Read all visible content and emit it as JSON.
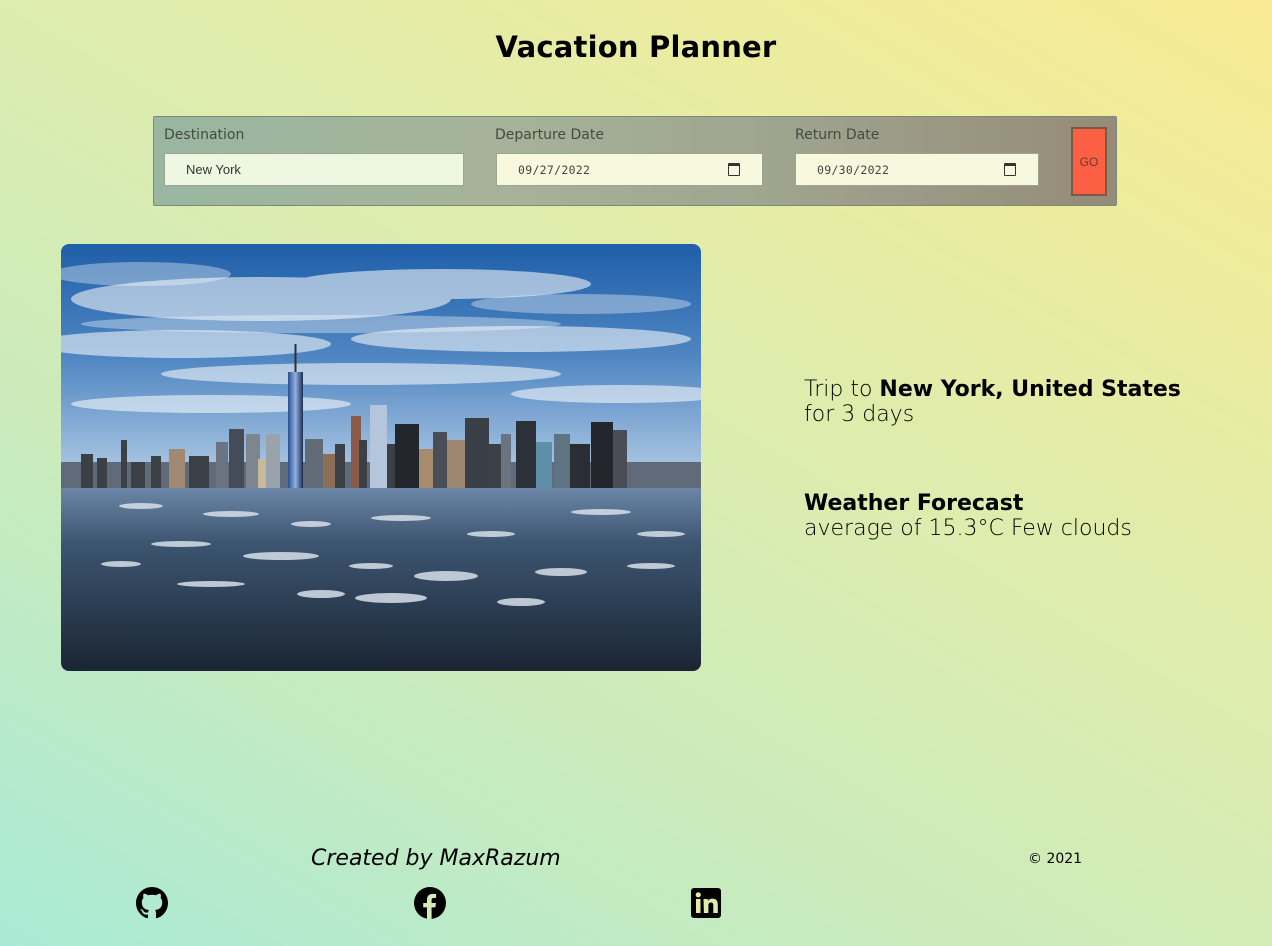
{
  "app": {
    "title": "Vacation Planner"
  },
  "form": {
    "destination_label": "Destination",
    "destination_value": "New York",
    "departure_label": "Departure Date",
    "departure_value": "09/27/2022",
    "return_label": "Return Date",
    "return_value": "09/30/2022",
    "go_label": "GO",
    "go_color": "#fb6044"
  },
  "trip": {
    "prefix": "Trip to ",
    "destination": "New York, United States",
    "duration": "for 3 days"
  },
  "weather": {
    "heading": "Weather Forecast",
    "summary": "average of 15.3°C Few clouds"
  },
  "footer": {
    "credit": "Created by MaxRazum",
    "copyright": "© 2021",
    "social": [
      "github-icon",
      "facebook-icon",
      "linkedin-icon"
    ]
  }
}
